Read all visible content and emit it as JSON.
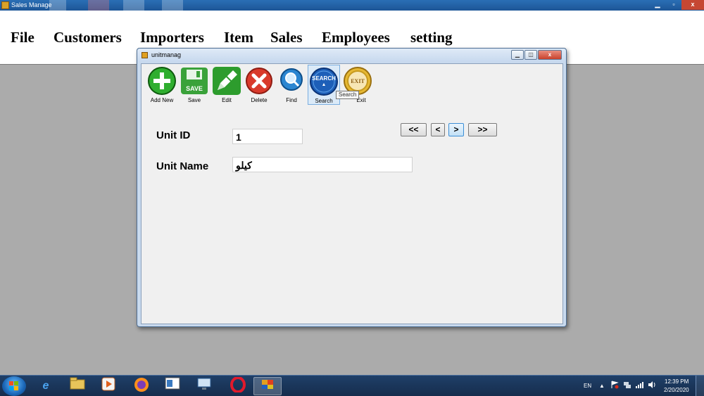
{
  "main_window": {
    "title": "Sales Manage",
    "controls": {
      "minimize": "▁",
      "maximize": "▫",
      "close": "x"
    }
  },
  "menubar": {
    "items": [
      "File",
      "Customers",
      "Importers",
      "Item",
      "Sales",
      "Employees",
      "setting"
    ]
  },
  "child_window": {
    "title": "unitmanag",
    "controls": {
      "minimize": "▁",
      "restore": "◫",
      "close": "x"
    }
  },
  "toolbar": {
    "buttons": [
      {
        "label": "Add New",
        "icon": "add-icon",
        "color": "#2fae2f"
      },
      {
        "label": "Save",
        "icon": "save-icon",
        "color": "#3aa23a",
        "text": "SAVE"
      },
      {
        "label": "Edit",
        "icon": "edit-icon",
        "color": "#2d9c2d"
      },
      {
        "label": "Delete",
        "icon": "delete-icon",
        "color": "#d93a2b"
      },
      {
        "label": "Find",
        "icon": "find-icon",
        "color": "#2b86d1"
      },
      {
        "label": "Search",
        "icon": "search-icon",
        "color": "#1d5fb8",
        "text": "SEARCH"
      },
      {
        "label": "Exit",
        "icon": "exit-icon",
        "color": "#e6b833",
        "text": "EXIT"
      }
    ],
    "tooltip": "Search"
  },
  "form": {
    "unit_id_label": "Unit ID",
    "unit_id_value": "1",
    "unit_name_label": "Unit Name",
    "unit_name_value": "كيلو"
  },
  "navigation": {
    "first": "<<",
    "prev": "<",
    "next": ">",
    "last": ">>"
  },
  "taskbar": {
    "language": "EN",
    "time": "12:39 PM",
    "date": "2/20/2020"
  }
}
